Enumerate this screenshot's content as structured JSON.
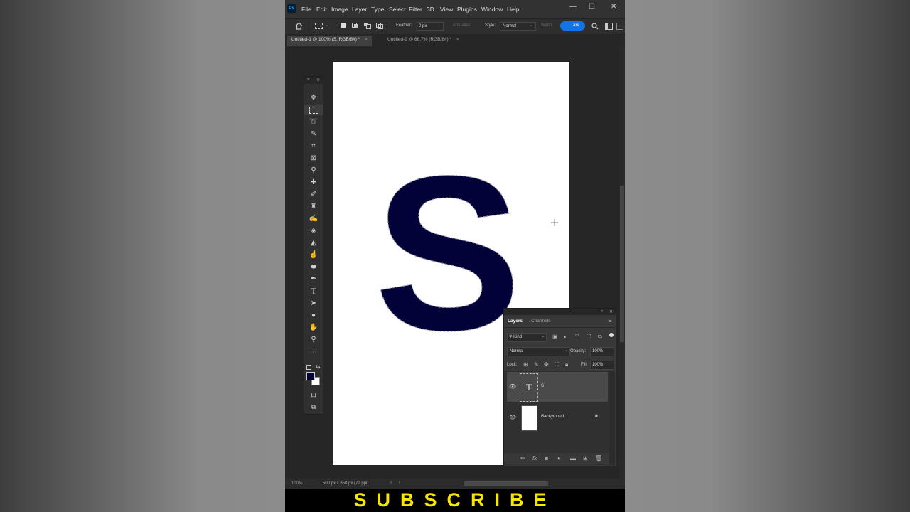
{
  "app": {
    "logo": "Ps"
  },
  "menu": [
    "File",
    "Edit",
    "Image",
    "Layer",
    "Type",
    "Select",
    "Filter",
    "3D",
    "View",
    "Plugins",
    "Window",
    "Help"
  ],
  "window_controls": {
    "minimize": "—",
    "maximize": "☐",
    "close": "✕"
  },
  "options": {
    "feather_label": "Feather:",
    "feather_value": "0 px",
    "anti_alias_label": "Anti-alias",
    "style_label": "Style:",
    "style_value": "Normal",
    "width_label": "Width:",
    "highlight_text": "are"
  },
  "tabs": [
    {
      "label": "Untitled-1 @ 100% (S, RGB/8#) *",
      "close": "×",
      "active": true
    },
    {
      "label": "Untitled-2 @ 66.7% (RGB/8#) *",
      "close": "×",
      "active": false
    }
  ],
  "canvas": {
    "letter": "S",
    "letter_color": "#020238"
  },
  "layers_panel": {
    "tab_layers": "Layers",
    "tab_channels": "Channels",
    "filter_kind": "Kind",
    "blend_mode": "Normal",
    "opacity_label": "Opacity:",
    "opacity_value": "100%",
    "lock_label": "Lock:",
    "fill_label": "Fill:",
    "fill_value": "100%",
    "layers": [
      {
        "name": "S",
        "type": "text",
        "thumb_glyph": "T",
        "selected": true
      },
      {
        "name": "Background",
        "type": "image",
        "locked": true,
        "selected": false
      }
    ]
  },
  "status": {
    "zoom": "100%",
    "doc_info": "500 px x 850 px (72 ppi)"
  },
  "banner": {
    "text": "SUBSCRIBE",
    "color": "#f6e600"
  },
  "colors": {
    "accent": "#1473e6",
    "foreground_swatch": "#020238",
    "background_swatch": "#ffffff"
  },
  "tools": [
    "move-icon",
    "rect-marquee-icon",
    "lasso-icon",
    "quick-select-icon",
    "crop-icon",
    "frame-icon",
    "eyedropper-icon",
    "healing-brush-icon",
    "brush-icon",
    "clone-stamp-icon",
    "history-brush-icon",
    "eraser-icon",
    "paint-bucket-icon",
    "smudge-icon",
    "dodge-icon",
    "pen-icon",
    "type-icon",
    "path-select-icon",
    "ellipse-icon",
    "hand-icon",
    "zoom-icon",
    "more-tools-icon"
  ]
}
